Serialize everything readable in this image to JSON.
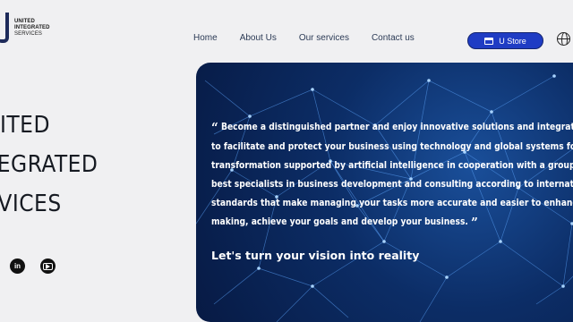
{
  "logo": {
    "line1": "UNITED",
    "line2": "INTEGRATED",
    "line3": "SERVICES"
  },
  "nav": {
    "items": [
      "Home",
      "About Us",
      "Our services",
      "Contact us"
    ]
  },
  "store_button": {
    "label": "U Store"
  },
  "hero_title": {
    "lines": [
      "NITED",
      "TEGRATED",
      "RVICES"
    ]
  },
  "socials": {
    "items": [
      "linkedin-icon",
      "youtube-icon"
    ],
    "linkedin_label": "in"
  },
  "hero": {
    "quote_lines": [
      "Become a distinguished partner and enjoy innovative solutions and integrated s",
      "to facilitate and protect your business using technology and global systems for dig",
      "transformation supported by artificial intelligence in cooperation with a group of t",
      "best specialists in business development and consulting according to internationa",
      "standards that make managing your tasks more accurate and easier to enhance de",
      "making, achieve your goals and develop your business."
    ],
    "open_quote": "“",
    "close_quote": "”",
    "tagline": "Let's turn your vision into reality"
  },
  "colors": {
    "accent": "#1f3cc4",
    "hero_bg": "#0c2d66",
    "text_dark": "#161a22"
  }
}
